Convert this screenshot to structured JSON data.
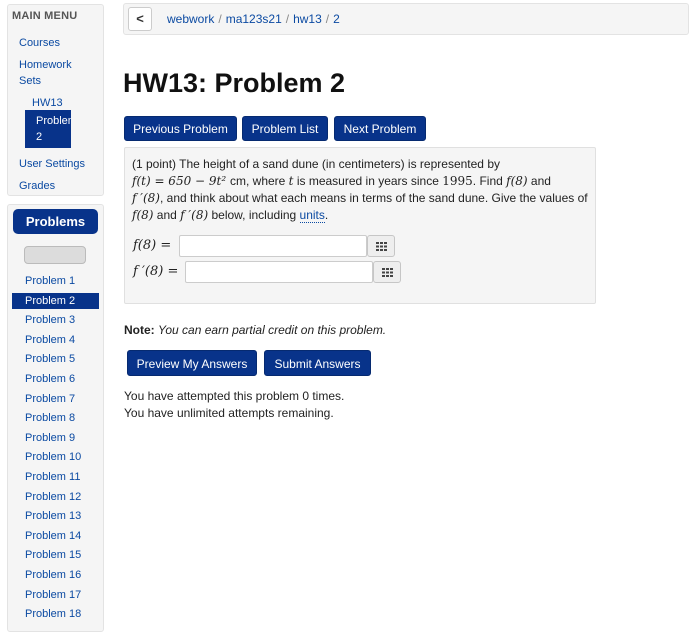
{
  "sidebar": {
    "menu_title": "MAIN MENU",
    "courses": "Courses",
    "homework_sets_1": "Homework",
    "homework_sets_2": "Sets",
    "hw13": "HW13",
    "active_problem_1": "Problem",
    "active_problem_2": "2",
    "user_settings": "User Settings",
    "grades": "Grades",
    "problems_header": "Problems",
    "problems": [
      "Problem 1",
      "Problem 2",
      "Problem 3",
      "Problem 4",
      "Problem 5",
      "Problem 6",
      "Problem 7",
      "Problem 8",
      "Problem 9",
      "Problem 10",
      "Problem 11",
      "Problem 12",
      "Problem 13",
      "Problem 14",
      "Problem 15",
      "Problem 16",
      "Problem 17",
      "Problem 18"
    ],
    "active_index": 1
  },
  "breadcrumb": {
    "back": "<",
    "items": [
      "webwork",
      "ma123s21",
      "hw13",
      "2"
    ],
    "separator": "/"
  },
  "page_title": "HW13: Problem 2",
  "nav": {
    "previous": "Previous Problem",
    "list": "Problem List",
    "next": "Next Problem"
  },
  "problem": {
    "intro": "(1 point) The height of a sand dune (in centimeters) is represented by",
    "line2_fn": "f(t) = 650 − 9t² ",
    "line2_text": "cm, where ",
    "line2_var": "t",
    "line2_text2": " is measured in years since ",
    "line2_year": "1995",
    "line2_text3": ". Find ",
    "line2_f8": "f(8)",
    "line2_text4": " and",
    "line3_fp8": "f ′(8)",
    "line3_text": ", and think about what each means in terms of the sand dune. Give the values of",
    "line4_f8": "f(8)",
    "line4_and": " and ",
    "line4_fp8": "f ′(8)",
    "line4_text": " below, including ",
    "units_link": "units",
    "line4_end": ".",
    "answer1_label": "f(8) =",
    "answer2_label": "f ′(8) =",
    "answer1_value": "",
    "answer2_value": ""
  },
  "note": {
    "label": "Note:",
    "text": "You can earn partial credit on this problem."
  },
  "actions": {
    "preview": "Preview My Answers",
    "submit": "Submit Answers"
  },
  "attempts": {
    "line1": "You have attempted this problem 0 times.",
    "line2": "You have unlimited attempts remaining."
  },
  "colors": {
    "primary": "#08338a",
    "link": "#0b4aa2",
    "panel": "#f5f5f5"
  },
  "icons": {
    "grid": "grid-icon",
    "back": "chevron-left-icon"
  }
}
